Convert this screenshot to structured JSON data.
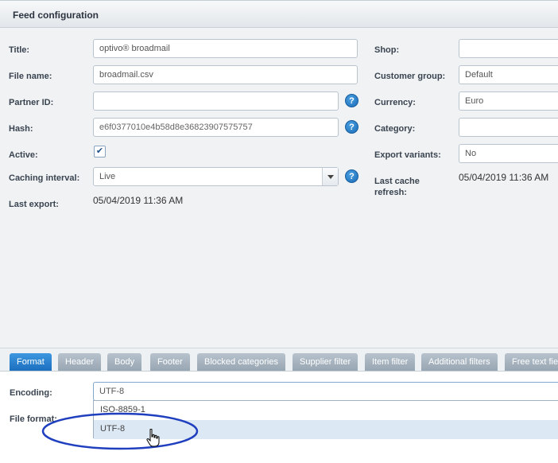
{
  "window": {
    "title": "Feed configuration"
  },
  "left": {
    "title_label": "Title:",
    "title_value": "optivo® broadmail",
    "filename_label": "File name:",
    "filename_value": "broadmail.csv",
    "partnerid_label": "Partner ID:",
    "partnerid_value": "",
    "hash_label": "Hash:",
    "hash_value": "e6f0377010e4b58d8e36823907575757",
    "active_label": "Active:",
    "active_checked": "✔",
    "caching_label": "Caching interval:",
    "caching_value": "Live",
    "lastexport_label": "Last export:",
    "lastexport_value": "05/04/2019 11:36 AM",
    "help_glyph": "?"
  },
  "right": {
    "shop_label": "Shop:",
    "shop_value": "",
    "customergroup_label": "Customer group:",
    "customergroup_value": "Default",
    "currency_label": "Currency:",
    "currency_value": "Euro",
    "category_label": "Category:",
    "category_value": "",
    "exportvariants_label": "Export variants:",
    "exportvariants_value": "No",
    "lastcache_label_line1": "Last cache",
    "lastcache_label_line2": "refresh:",
    "lastcache_value": "05/04/2019 11:36 AM"
  },
  "tabs": [
    {
      "label": "Format",
      "active": true
    },
    {
      "label": "Header"
    },
    {
      "label": "Body"
    },
    {
      "label": "Footer"
    },
    {
      "label": "Blocked categories"
    },
    {
      "label": "Supplier filter"
    },
    {
      "label": "Item filter"
    },
    {
      "label": "Additional filters"
    },
    {
      "label": "Free text fie"
    }
  ],
  "format": {
    "encoding_label": "Encoding:",
    "encoding_value": "UTF-8",
    "fileformat_label": "File format:",
    "encoding_options": [
      "ISO-8859-1",
      "UTF-8"
    ],
    "hovered_option": "UTF-8"
  },
  "colors": {
    "active_tab": "#1c6fbf",
    "inactive_tab": "#98a6b3",
    "annotation_ellipse": "#1f3fbf",
    "help_icon": "#1a6cb8"
  },
  "icons": [
    "help-icon",
    "checkmark-icon",
    "dropdown-arrow-icon",
    "hand-pointer-icon"
  ]
}
